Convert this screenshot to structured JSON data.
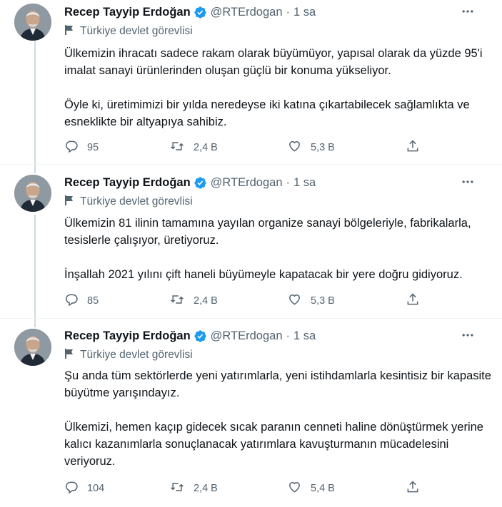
{
  "tweets": [
    {
      "name": "Recep Tayyip Erdoğan",
      "handle": "@RTErdogan",
      "dot": "·",
      "time": "1 sa",
      "label": "Türkiye devlet görevlisi",
      "paragraphs": [
        "Ülkemizin ihracatı sadece rakam olarak büyümüyor, yapısal olarak da yüzde 95'i imalat sanayi ürünlerinden oluşan güçlü bir konuma yükseliyor.",
        "Öyle ki, üretimimizi bir yılda neredeyse iki katına çıkartabilecek sağlamlıkta ve esneklikte bir altyapıya sahibiz."
      ],
      "replies": "95",
      "retweets": "2,4 B",
      "likes": "5,3 B"
    },
    {
      "name": "Recep Tayyip Erdoğan",
      "handle": "@RTErdogan",
      "dot": "·",
      "time": "1 sa",
      "label": "Türkiye devlet görevlisi",
      "paragraphs": [
        "Ülkemizin 81 ilinin tamamına yayılan organize sanayi bölgeleriyle, fabrikalarla, tesislerle çalışıyor, üretiyoruz.",
        "İnşallah 2021 yılını çift haneli büyümeyle kapatacak bir yere doğru gidiyoruz."
      ],
      "replies": "85",
      "retweets": "2,4 B",
      "likes": "5,3 B"
    },
    {
      "name": "Recep Tayyip Erdoğan",
      "handle": "@RTErdogan",
      "dot": "·",
      "time": "1 sa",
      "label": "Türkiye devlet görevlisi",
      "paragraphs": [
        "Şu anda tüm sektörlerde yeni yatırımlarla, yeni istihdamlarla kesintisiz bir kapasite büyütme yarışındayız.",
        "Ülkemizi, hemen kaçıp gidecek sıcak paranın cenneti haline dönüştürmek yerine kalıcı kazanımlarla sonuçlanacak yatırımlara kavuşturmanın mücadelesini veriyoruz."
      ],
      "replies": "104",
      "retweets": "2,4 B",
      "likes": "5,4 B"
    }
  ],
  "colors": {
    "text": "#0f1419",
    "secondary": "#536471",
    "verified": "#1d9bf0",
    "rail": "#cfd9de",
    "divider": "#eff3f4"
  },
  "icons": {
    "verified": "verified-badge-icon",
    "label": "flag-icon",
    "reply": "reply-icon",
    "retweet": "retweet-icon",
    "like": "heart-icon",
    "share": "share-icon",
    "more": "more-icon"
  }
}
